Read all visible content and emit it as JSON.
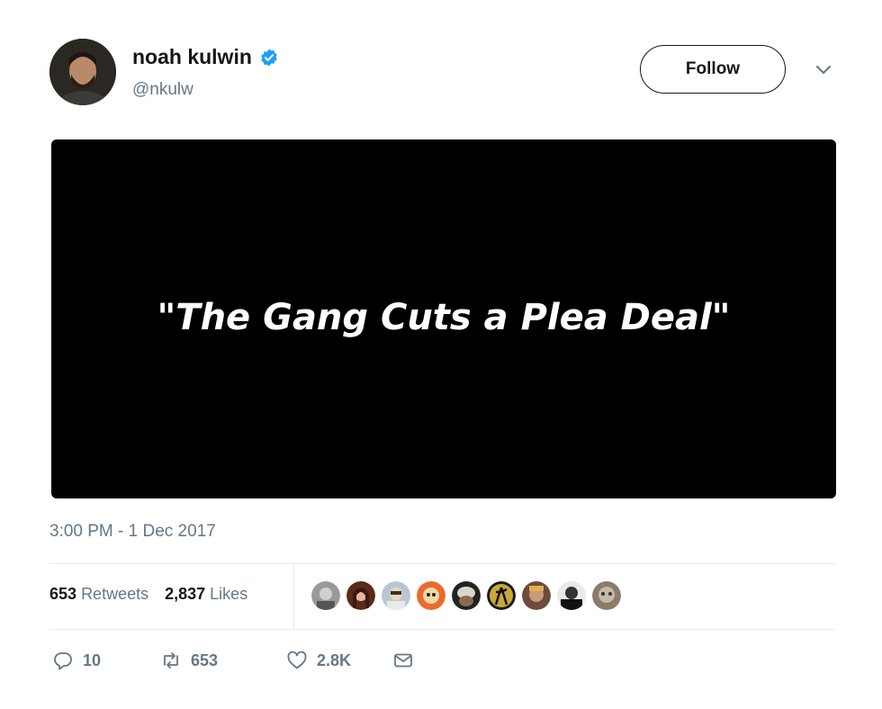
{
  "tweet": {
    "author": {
      "display_name": "noah kulwin",
      "handle": "@nkulw",
      "verified": true,
      "verified_color": "#1da1f2"
    },
    "follow_label": "Follow",
    "media_caption": "\"The Gang Cuts a Plea Deal\"",
    "timestamp": "3:00 PM - 1 Dec 2017",
    "stats": {
      "retweets_count": "653",
      "retweets_label": "Retweets",
      "likes_count": "2,837",
      "likes_label": "Likes"
    },
    "actions": {
      "replies": "10",
      "retweets": "653",
      "likes": "2.8K"
    },
    "liker_avatar_count": 9
  },
  "colors": {
    "text_primary": "#14171a",
    "text_secondary": "#657786",
    "divider": "#e6ecf0",
    "media_background": "#000000"
  },
  "icons": [
    "verified-badge-icon",
    "chevron-down-icon",
    "reply-icon",
    "retweet-icon",
    "like-icon",
    "direct-message-icon"
  ]
}
